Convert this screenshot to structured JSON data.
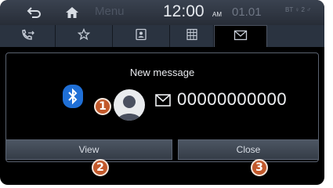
{
  "status_bar": {
    "menu_label": "Menu",
    "time": "12:00",
    "ampm": "AM",
    "date": "01.01",
    "system_icons": "BT ♀ 2 ♂"
  },
  "tabs": [
    {
      "icon": "phone-transfer-icon"
    },
    {
      "icon": "star-icon"
    },
    {
      "icon": "contacts-icon"
    },
    {
      "icon": "keypad-icon"
    },
    {
      "icon": "message-icon",
      "active": true
    }
  ],
  "popup": {
    "title": "New message",
    "number": "00000000000",
    "view_label": "View",
    "close_label": "Close"
  },
  "callouts": {
    "one": "1",
    "two": "2",
    "three": "3"
  },
  "colors": {
    "callout": "#c2592b",
    "bluetooth": "#1f6fd6",
    "panel": "#000000",
    "status_bar": "#2f3641"
  }
}
